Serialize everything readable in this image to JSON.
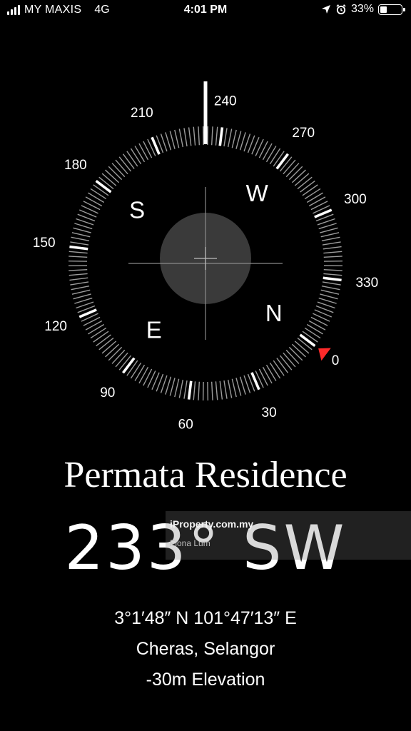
{
  "status_bar": {
    "carrier": "MY MAXIS",
    "network": "4G",
    "time": "4:01 PM",
    "battery_percent": "33%",
    "battery_level": 0.33,
    "icons": [
      "signal-bars-icon",
      "location-arrow-icon",
      "alarm-clock-icon",
      "battery-icon"
    ]
  },
  "compass": {
    "heading_degrees": 233,
    "degree_labels": [
      "0",
      "30",
      "60",
      "90",
      "120",
      "150",
      "180",
      "210",
      "240",
      "270",
      "300",
      "330"
    ],
    "cardinals": [
      "N",
      "E",
      "S",
      "W"
    ],
    "pointer_color": "#ff2a2a"
  },
  "overlay": {
    "title": "Permata Residence",
    "watermark_logo": "iProperty.com.my",
    "watermark_name": "Fiona Lum"
  },
  "readout": {
    "heading_number": "233°",
    "heading_direction": "SW",
    "coordinates": "3°1′48″ N  101°47′13″ E",
    "locality": "Cheras, Selangor",
    "elevation": "-30m Elevation"
  }
}
